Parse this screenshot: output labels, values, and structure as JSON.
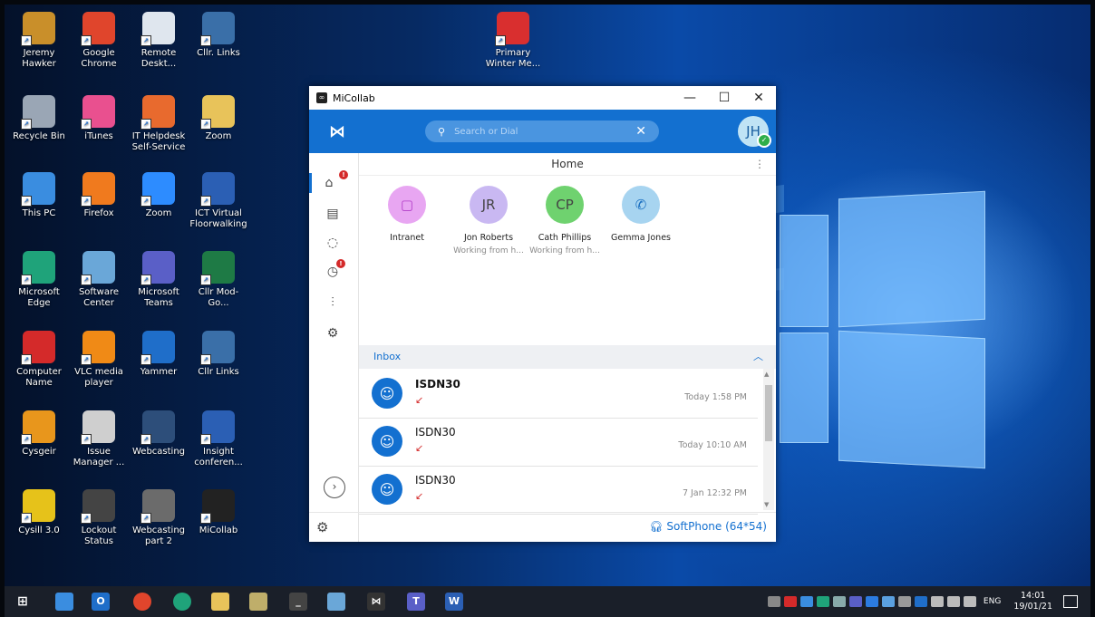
{
  "desktop_icons": [
    {
      "label": "Jeremy Hawker",
      "icon": "user-folder-icon",
      "color": "#c98f2a"
    },
    {
      "label": "Google Chrome",
      "icon": "chrome-icon",
      "color": "#e0452c"
    },
    {
      "label": "Remote Deskt...",
      "icon": "remote-desktop-icon",
      "color": "#dfe6ee"
    },
    {
      "label": "Cllr. Links",
      "icon": "web-link-icon",
      "color": "#3a6fa8"
    },
    {
      "label": "Recycle Bin",
      "icon": "recycle-bin-icon",
      "color": "#9aa6b5"
    },
    {
      "label": "iTunes",
      "icon": "itunes-icon",
      "color": "#e9508f"
    },
    {
      "label": "IT Helpdesk Self-Service",
      "icon": "lifebuoy-icon",
      "color": "#e86a2e"
    },
    {
      "label": "Zoom",
      "icon": "folder-icon",
      "color": "#e8c35a"
    },
    {
      "label": "This PC",
      "icon": "computer-icon",
      "color": "#3a8de0"
    },
    {
      "label": "Firefox",
      "icon": "firefox-icon",
      "color": "#f07a1e"
    },
    {
      "label": "Zoom",
      "icon": "zoom-icon",
      "color": "#2d8cff"
    },
    {
      "label": "ICT Virtual Floorwalking",
      "icon": "word-doc-icon",
      "color": "#2b5fb4"
    },
    {
      "label": "Microsoft Edge",
      "icon": "edge-icon",
      "color": "#1fa37a"
    },
    {
      "label": "Software Center",
      "icon": "software-center-icon",
      "color": "#6aa7d8"
    },
    {
      "label": "Microsoft Teams",
      "icon": "teams-icon",
      "color": "#5a5fc7"
    },
    {
      "label": "Cllr Mod-Go...",
      "icon": "excel-doc-icon",
      "color": "#1e7a45"
    },
    {
      "label": "Computer Name",
      "icon": "question-icon",
      "color": "#d42a2a"
    },
    {
      "label": "VLC media player",
      "icon": "vlc-icon",
      "color": "#f08a16"
    },
    {
      "label": "Yammer",
      "icon": "yammer-icon",
      "color": "#1f6ec9"
    },
    {
      "label": "Cllr Links",
      "icon": "web-link-icon",
      "color": "#3a6fa8"
    },
    {
      "label": "Cysgeir",
      "icon": "cysgeir-icon",
      "color": "#e8961c"
    },
    {
      "label": "Issue Manager ...",
      "icon": "issue-manager-icon",
      "color": "#cfcfcf"
    },
    {
      "label": "Webcasting",
      "icon": "video-icon",
      "color": "#2d4e7a"
    },
    {
      "label": "Insight conferen...",
      "icon": "word-doc-icon",
      "color": "#2b5fb4"
    },
    {
      "label": "Cysill 3.0",
      "icon": "cysill-icon",
      "color": "#e6c21a"
    },
    {
      "label": "Lockout Status",
      "icon": "lockout-icon",
      "color": "#444444"
    },
    {
      "label": "Webcasting part 2",
      "icon": "video-icon",
      "color": "#6b6b6b"
    },
    {
      "label": "MiCollab",
      "icon": "micollab-icon",
      "color": "#222222"
    },
    {
      "label": "Primary Winter Me...",
      "icon": "pdf-icon",
      "color": "#d92f2f"
    }
  ],
  "window": {
    "title": "MiCollab",
    "minimize": "—",
    "maximize": "☐",
    "close": "✕",
    "search_placeholder": "Search or Dial",
    "avatar": "JH",
    "home_title": "Home",
    "favorites": [
      {
        "name": "Intranet",
        "status": "",
        "initials": "",
        "color": "#e8a6f2"
      },
      {
        "name": "Jon Roberts",
        "status": "Working from h...",
        "initials": "JR",
        "color": "#c9b8f2",
        "presence": "#888888"
      },
      {
        "name": "Cath Phillips",
        "status": "Working from h...",
        "initials": "CP",
        "color": "#6fd26f",
        "presence": "#d42a2a"
      },
      {
        "name": "Gemma Jones",
        "status": "",
        "initials": "",
        "color": "#a7d4f0"
      }
    ],
    "inbox_label": "Inbox",
    "messages": [
      {
        "name": "ISDN30",
        "time": "Today 1:58 PM",
        "unread": true
      },
      {
        "name": "ISDN30",
        "time": "Today 10:10 AM",
        "unread": false
      },
      {
        "name": "ISDN30",
        "time": "7 Jan 12:32 PM",
        "unread": false
      }
    ],
    "softphone": "SoftPhone (64*54)"
  },
  "taskbar": {
    "lang": "ENG",
    "time": "14:01",
    "date": "19/01/21"
  }
}
